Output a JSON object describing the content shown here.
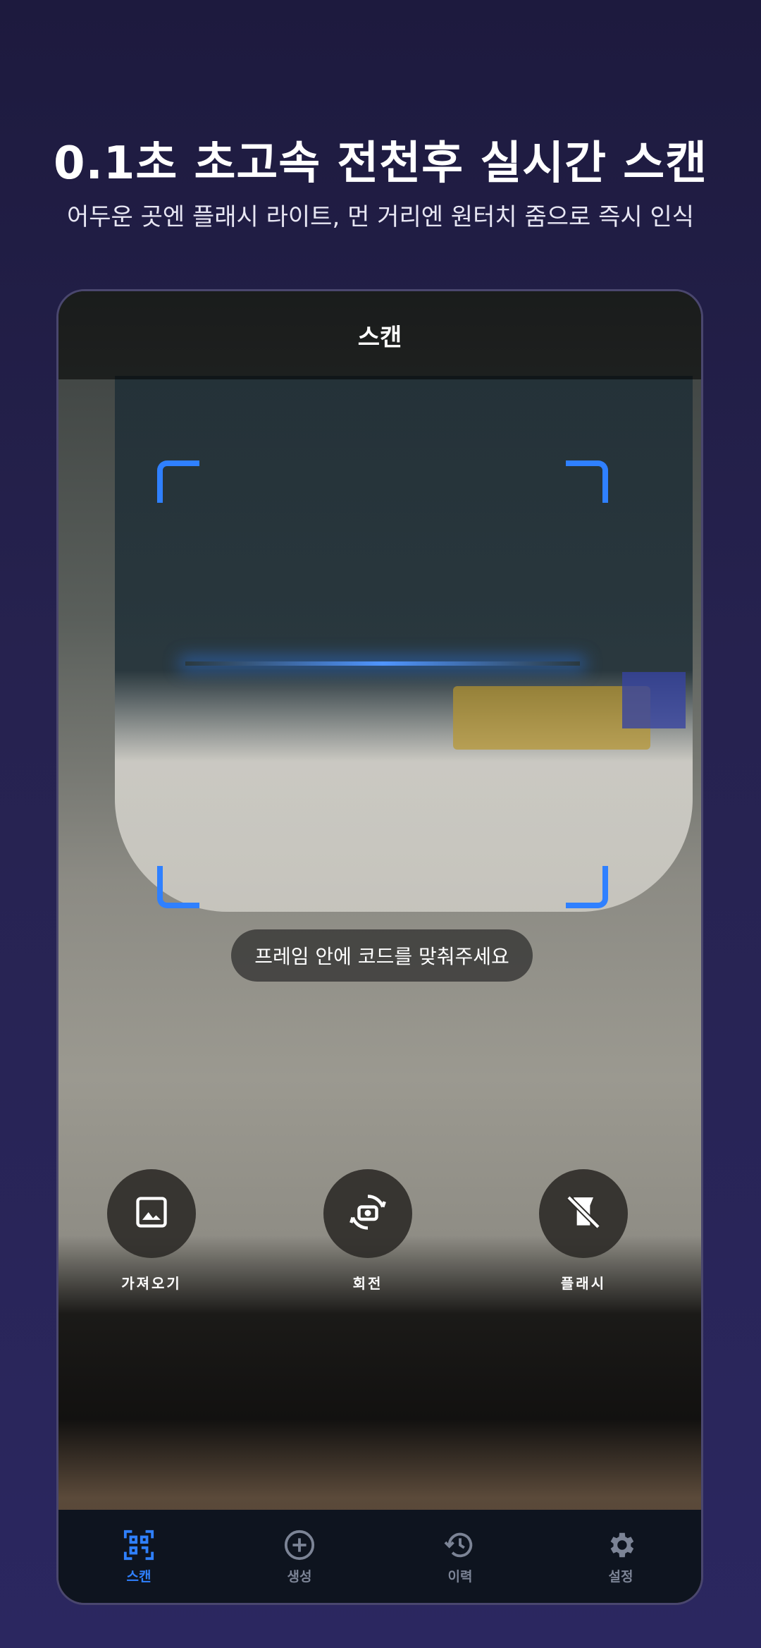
{
  "promo": {
    "headline": "0.1초 초고속 전천후 실시간 스캔",
    "subline": "어두운 곳엔 플래시 라이트, 먼 거리엔 원터치 줌으로 즉시 인식"
  },
  "screen": {
    "title": "스캔",
    "hint": "프레임 안에 코드를 맞춰주세요",
    "colors": {
      "accent": "#2f80ff",
      "nav_background": "#0e141f"
    }
  },
  "actions": [
    {
      "label": "가져오기",
      "icon": "image-icon"
    },
    {
      "label": "회전",
      "icon": "camera-rotate-icon"
    },
    {
      "label": "플래시",
      "icon": "flash-off-icon"
    }
  ],
  "nav": [
    {
      "label": "스캔",
      "icon": "qr-scan-icon",
      "active": true
    },
    {
      "label": "생성",
      "icon": "plus-circle-icon",
      "active": false
    },
    {
      "label": "이력",
      "icon": "history-icon",
      "active": false
    },
    {
      "label": "설정",
      "icon": "gear-icon",
      "active": false
    }
  ]
}
